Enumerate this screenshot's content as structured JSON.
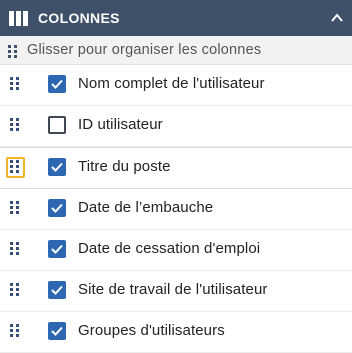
{
  "header": {
    "title": "COLONNES",
    "columns_icon": "columns-icon",
    "collapse_icon": "chevron-up-icon",
    "background": "#3f5069"
  },
  "hint": {
    "text": "Glisser pour organiser les colonnes",
    "icon": "drag-handle-icon"
  },
  "columns": [
    {
      "label": "Nom complet de l'utilisateur",
      "checked": true
    },
    {
      "label": "ID utilisateur",
      "checked": false
    },
    {
      "label": "Titre du poste",
      "checked": true,
      "focused": true
    },
    {
      "label": "Date de l’embauche",
      "checked": true
    },
    {
      "label": "Date de cessation d'emploi",
      "checked": true
    },
    {
      "label": "Site de travail de l'utilisateur",
      "checked": true
    },
    {
      "label": "Groupes d'utilisateurs",
      "checked": true
    }
  ],
  "colors": {
    "checkbox_checked": "#2e67b1",
    "drag_handle": "#37507a",
    "focus_outline": "#f0b429"
  }
}
